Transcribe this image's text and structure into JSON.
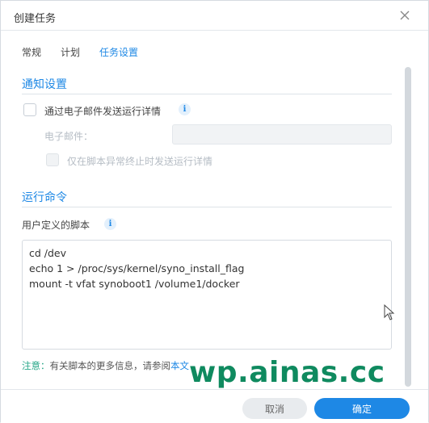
{
  "window": {
    "title": "创建任务"
  },
  "icons": {
    "close": "close-icon",
    "info": "info-icon",
    "cursor": "mouse-pointer-icon"
  },
  "tabs": [
    {
      "label": "常规",
      "active": false
    },
    {
      "label": "计划",
      "active": false
    },
    {
      "label": "任务设置",
      "active": true
    }
  ],
  "notification": {
    "heading": "通知设置",
    "send_email_label": "通过电子邮件发送运行详情",
    "send_email_checked": false,
    "email_label": "电子邮件：",
    "email_value": "",
    "abnormal_only_label": "仅在脚本异常终止时发送运行详情",
    "abnormal_only_checked": false
  },
  "run_command": {
    "heading": "运行命令",
    "script_label": "用户定义的脚本",
    "script_lines": [
      "cd /dev",
      "echo 1 > /proc/sys/kernel/syno_install_flag",
      "mount -t vfat synoboot1 /volume1/docker"
    ]
  },
  "note": {
    "prefix": "注意：",
    "text": "有关脚本的更多信息，请参阅",
    "link": "本文"
  },
  "footer": {
    "cancel_label": "取消",
    "ok_label": "确定"
  },
  "watermark": "wp.ainas.cc",
  "colors": {
    "accent": "#1e88e5",
    "note_prefix": "#2aa88a",
    "watermark": "#0f8a5f"
  }
}
